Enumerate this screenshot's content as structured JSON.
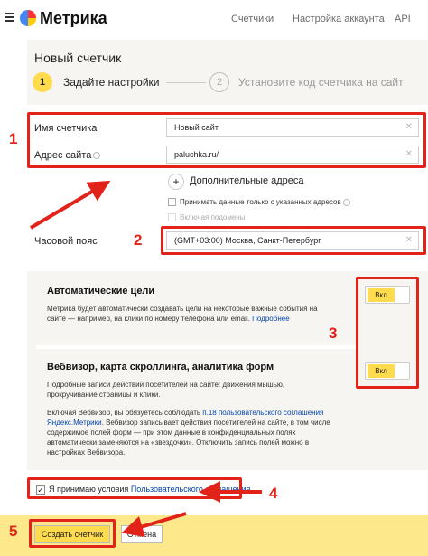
{
  "header": {
    "logo": "Метрика",
    "nav": [
      "Счетчики",
      "Настройка аккаунта",
      "API"
    ]
  },
  "page": {
    "title": "Новый счетчик",
    "steps": [
      {
        "number": "1",
        "label": "Задайте настройки"
      },
      {
        "number": "2",
        "label": "Установите код счетчика на сайт"
      }
    ]
  },
  "form": {
    "counter_name_label": "Имя счетчика",
    "counter_name_value": "Новый сайт",
    "site_url_label": "Адрес сайта",
    "site_url_value": "paluchka.ru/",
    "additional_addresses": "Дополнительные адреса",
    "only_listed_addresses": "Принимать данные только с указанных адресов",
    "include_subdomains": "Включая подомены",
    "timezone_label": "Часовой пояс",
    "timezone_value": "(GMT+03:00) Москва, Санкт-Петербург"
  },
  "features": {
    "auto_goals": {
      "title": "Автоматические цели",
      "text1": "Метрика будет автоматически создавать цели на некоторые важные события на",
      "text2": "сайте — например, на клики по номеру телефона или email.",
      "more": "Подробнее",
      "toggle": "Вкл"
    },
    "webvisor": {
      "title": "Вебвизор, карта скроллинга, аналитика форм",
      "text1": "Подробные записи действий посетителей на сайте: движения мышью,",
      "text2": "прокручивание страницы и клики.",
      "note1a": "Включая Вебвизор, вы обязуетесь соблюдать",
      "note1b": "п.18 пользовательского соглашения",
      "note2a": "Яндекс.Метрики.",
      "note2b": "Вебвизор записывает действия посетителей на сайте, в том числе",
      "note3": "содержимое полей форм — при этом данные в конфиденциальных полях",
      "note4": "автоматически заменяются на «звездочки». Отключить запись полей можно в",
      "note5": "настройках Вебвизора.",
      "toggle": "Вкл"
    }
  },
  "agreement": {
    "text": "Я принимаю условия",
    "link": "Пользовательского соглашения"
  },
  "footer": {
    "create": "Создать счетчик",
    "cancel": "Отмена"
  },
  "annotations": [
    "1",
    "2",
    "3",
    "4",
    "5"
  ],
  "colors": {
    "accent_yellow": "#ffdb4d",
    "footer_yellow": "#fde98c",
    "annotation_red": "#e2231a",
    "link_blue": "#0645ad"
  }
}
